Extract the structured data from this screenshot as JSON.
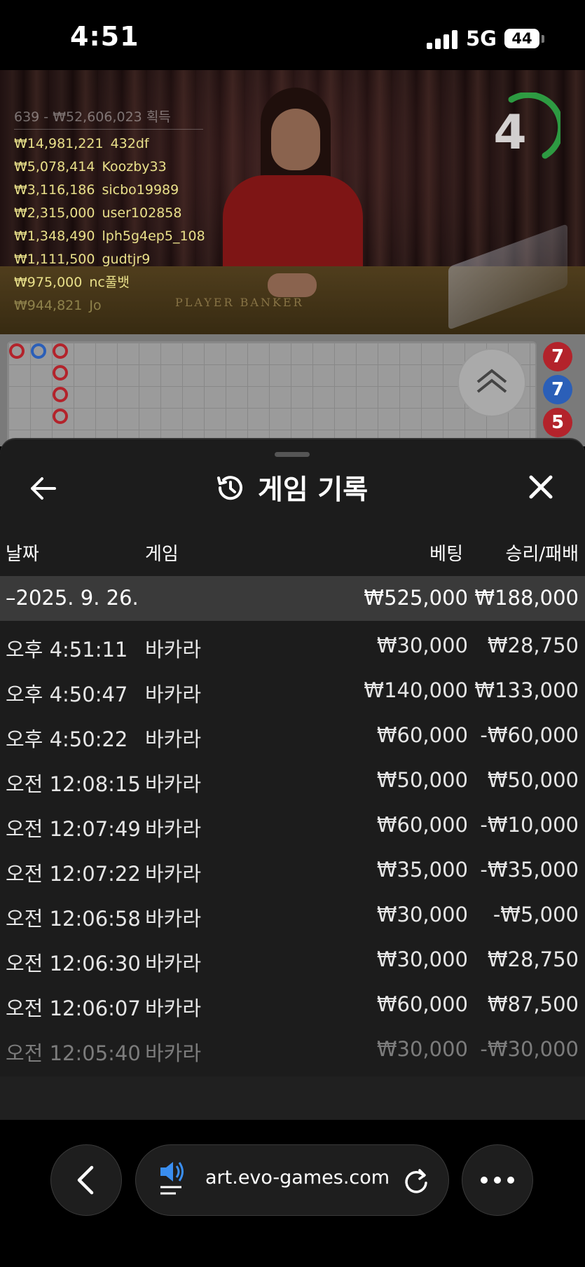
{
  "status_bar": {
    "time": "4:51",
    "network": "5G",
    "battery": "44"
  },
  "video": {
    "table_text": "PLAYER  BANKER",
    "timer": "4",
    "winners_header": "639 - ₩52,606,023 획득",
    "winners": [
      {
        "amount": "₩14,981,221",
        "user": "432df"
      },
      {
        "amount": "₩5,078,414",
        "user": "Koozby33"
      },
      {
        "amount": "₩3,116,186",
        "user": "sicbo19989"
      },
      {
        "amount": "₩2,315,000",
        "user": "user102858"
      },
      {
        "amount": "₩1,348,490",
        "user": "lph5g4ep5_108"
      },
      {
        "amount": "₩1,111,500",
        "user": "gudtjr9"
      },
      {
        "amount": "₩975,000",
        "user": "nc풀뱃"
      },
      {
        "amount": "₩944,821",
        "user": "Jo"
      }
    ]
  },
  "roadmap": {
    "side_chips": [
      "7",
      "7",
      "5"
    ]
  },
  "history": {
    "title": "게임 기록",
    "columns": {
      "date": "날짜",
      "game": "게임",
      "bet": "베팅",
      "win_loss": "승리/패배"
    },
    "date_summary": {
      "date": "–2025. 9. 26.",
      "bet": "₩525,000",
      "win_loss": "₩188,000"
    },
    "rows": [
      {
        "time": "오후 4:51:11",
        "game": "바카라",
        "bet": "₩30,000",
        "win_loss": "₩28,750"
      },
      {
        "time": "오후 4:50:47",
        "game": "바카라",
        "bet": "₩140,000",
        "win_loss": "₩133,000"
      },
      {
        "time": "오후 4:50:22",
        "game": "바카라",
        "bet": "₩60,000",
        "win_loss": "-₩60,000"
      },
      {
        "time": "오전 12:08:15",
        "game": "바카라",
        "bet": "₩50,000",
        "win_loss": "₩50,000"
      },
      {
        "time": "오전 12:07:49",
        "game": "바카라",
        "bet": "₩60,000",
        "win_loss": "-₩10,000"
      },
      {
        "time": "오전 12:07:22",
        "game": "바카라",
        "bet": "₩35,000",
        "win_loss": "-₩35,000"
      },
      {
        "time": "오전 12:06:58",
        "game": "바카라",
        "bet": "₩30,000",
        "win_loss": "-₩5,000"
      },
      {
        "time": "오전 12:06:30",
        "game": "바카라",
        "bet": "₩30,000",
        "win_loss": "₩28,750"
      },
      {
        "time": "오전 12:06:07",
        "game": "바카라",
        "bet": "₩60,000",
        "win_loss": "₩87,500"
      },
      {
        "time": "오전 12:05:40",
        "game": "바카라",
        "bet": "₩30,000",
        "win_loss": "-₩30,000"
      }
    ]
  },
  "browser": {
    "url": "art.evo-games.com"
  },
  "icons": {
    "back": "arrow-left-icon",
    "history": "history-clock-icon",
    "close": "close-icon",
    "scroll_up": "double-chevron-up-icon",
    "nav_back": "chevron-left-icon",
    "sound": "speaker-icon",
    "reload": "reload-icon",
    "more": "more-dots-icon"
  },
  "colors": {
    "winner_text": "#e9e08a",
    "banker_red": "#b3232b",
    "player_blue": "#2b5fb8",
    "timer_green": "#2fb34a"
  }
}
